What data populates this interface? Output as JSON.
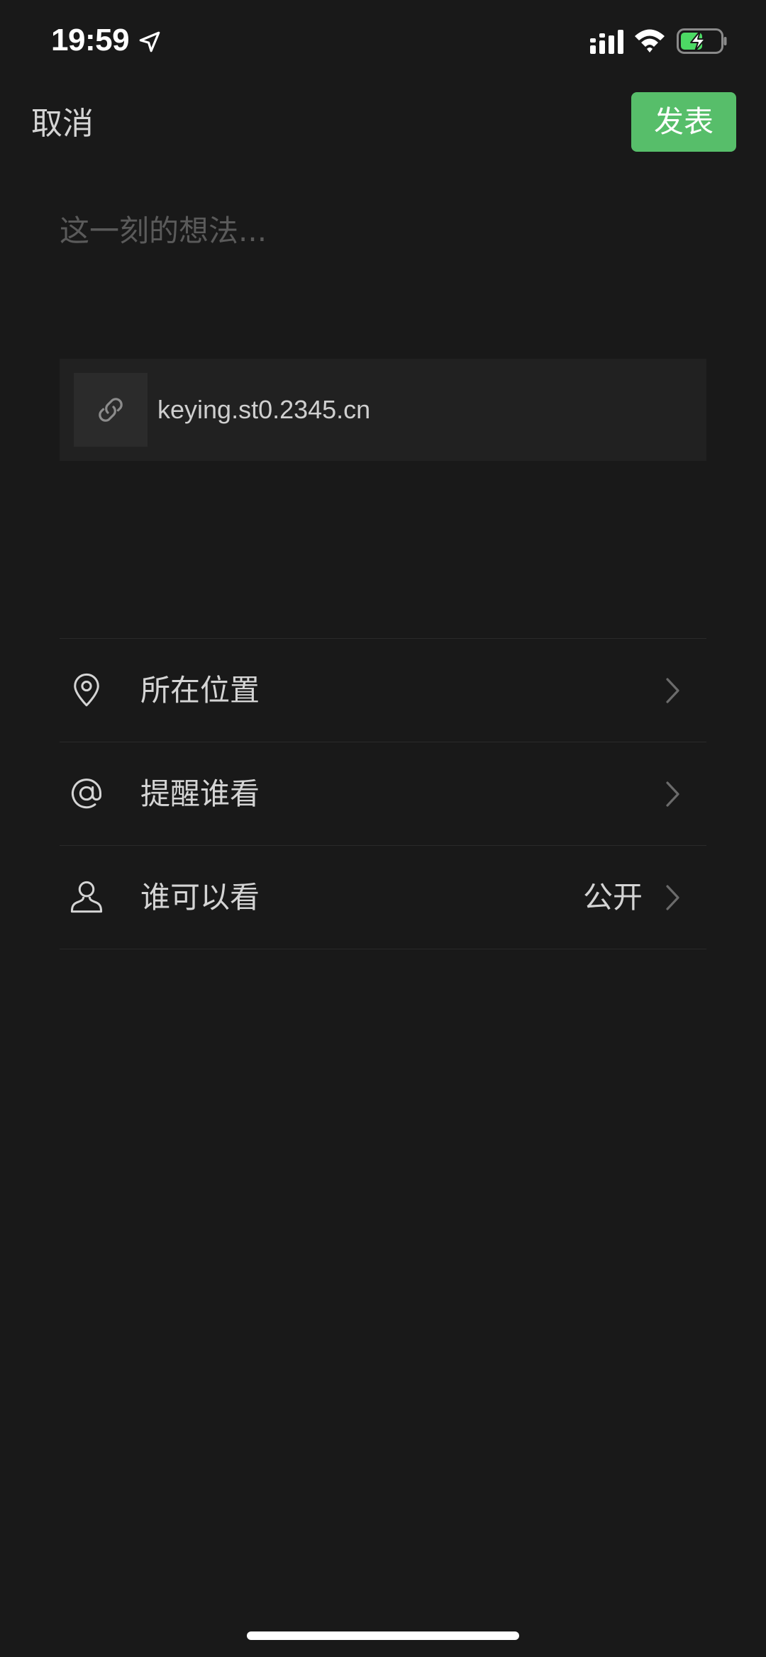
{
  "status_bar": {
    "time": "19:59",
    "location_icon": "location-arrow-icon",
    "signal_icon": "cellular-signal-icon",
    "wifi_icon": "wifi-icon",
    "battery_icon": "battery-charging-icon",
    "battery_color": "#4cd964"
  },
  "nav": {
    "cancel_label": "取消",
    "publish_label": "发表",
    "publish_color": "#57be6a"
  },
  "composer": {
    "placeholder": "这一刻的想法...",
    "value": ""
  },
  "link_card": {
    "icon": "link-icon",
    "url": "keying.st0.2345.cn"
  },
  "options": [
    {
      "icon": "location-pin-icon",
      "label": "所在位置",
      "value": ""
    },
    {
      "icon": "at-sign-icon",
      "label": "提醒谁看",
      "value": ""
    },
    {
      "icon": "person-icon",
      "label": "谁可以看",
      "value": "公开"
    }
  ]
}
